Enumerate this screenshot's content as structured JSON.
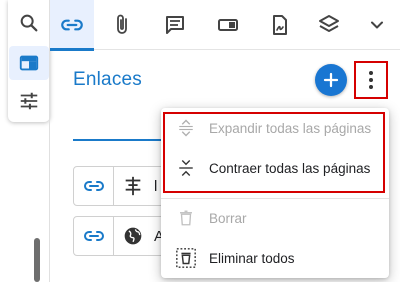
{
  "toolbar": {
    "tabs": [
      {
        "icon": "link-icon",
        "active": true
      },
      {
        "icon": "paperclip-icon",
        "active": false
      },
      {
        "icon": "comment-icon",
        "active": false
      },
      {
        "icon": "form-field-icon",
        "active": false
      },
      {
        "icon": "signature-icon",
        "active": false
      },
      {
        "icon": "layers-icon",
        "active": false
      },
      {
        "icon": "chevron-down-icon",
        "active": false
      }
    ]
  },
  "rail": {
    "items": [
      {
        "icon": "search-icon"
      },
      {
        "icon": "panel-icon",
        "active": true
      },
      {
        "icon": "sliders-icon"
      }
    ]
  },
  "panel": {
    "title": "Enlaces"
  },
  "link_rows": [
    {
      "icon": "text-align-icon",
      "text": "l"
    },
    {
      "icon": "globe-icon",
      "text": "A"
    }
  ],
  "menu": {
    "items": [
      {
        "label": "Expandir todas las páginas",
        "icon": "expand-icon",
        "enabled": false
      },
      {
        "label": "Contraer todas las páginas",
        "icon": "collapse-icon",
        "enabled": true
      },
      {
        "label": "Borrar",
        "icon": "trash-icon",
        "enabled": false
      },
      {
        "label": "Eliminar todos",
        "icon": "delete-all-icon",
        "enabled": true
      }
    ]
  },
  "colors": {
    "accent": "#1a7ac9",
    "add_button": "#1976d2",
    "highlight": "#d50000",
    "disabled_text": "#a8a8a8"
  }
}
